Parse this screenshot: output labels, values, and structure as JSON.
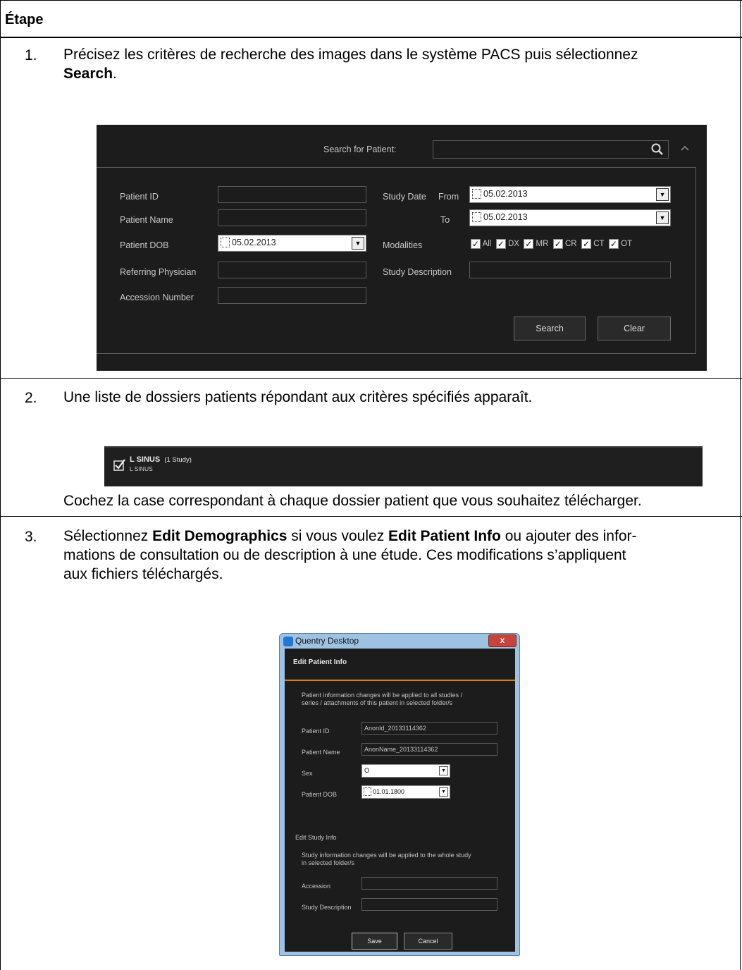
{
  "table": {
    "header": "Étape"
  },
  "step1": {
    "number": "1.",
    "text_before": "Précisez les critères de recherche des images dans le système PACS puis sélectionnez",
    "bold": "Search",
    "text_after": "."
  },
  "search_panel": {
    "search_for_patient_label": "Search for Patient:",
    "patient_id_label": "Patient ID",
    "patient_name_label": "Patient Name",
    "patient_dob_label": "Patient DOB",
    "patient_dob_value": "05.02.2013",
    "referring_physician_label": "Referring Physician",
    "accession_number_label": "Accession Number",
    "study_date_label": "Study Date",
    "from_label": "From",
    "from_value": "05.02.2013",
    "to_label": "To",
    "to_value": "05.02.2013",
    "modalities_label": "Modalities",
    "modalities": [
      "All",
      "DX",
      "MR",
      "CR",
      "CT",
      "OT"
    ],
    "study_description_label": "Study Description",
    "search_button": "Search",
    "clear_button": "Clear"
  },
  "step2": {
    "number": "2.",
    "text": "Une liste de dossiers patients répondant aux critères spécifiés apparaît.",
    "patient_name": "L SINUS",
    "study_count": "(1 Study)",
    "patient_sub": "L SINUS",
    "after_text": "Cochez la case correspondant à chaque dossier patient que vous souhaitez télécharger."
  },
  "step3": {
    "number": "3.",
    "line1_a": "Sélectionnez ",
    "line1_bold1": "Edit Demographics",
    "line1_b": " si vous voulez ",
    "line1_bold2": "Edit Patient Info",
    "line1_c": " ou ajouter des infor-",
    "line2": "mations de consultation ou de description à une étude. Ces modifications s’appliquent",
    "line3": "aux fichiers téléchargés."
  },
  "dialog": {
    "window_title": "Quentry Desktop",
    "close_glyph": "x",
    "header": "Edit Patient Info",
    "info_line1": "Patient information changes will be applied to all studies /",
    "info_line2": "series / attachments of this patient in selected folder/s",
    "patient_id_label": "Patient ID",
    "patient_id_value": "AnonId_20133114362",
    "patient_name_label": "Patient Name",
    "patient_name_value": "AnonName_20133114362",
    "sex_label": "Sex",
    "sex_value": "O",
    "dob_label": "Patient DOB",
    "dob_value": "01.01.1800",
    "study_section": "Edit Study Info",
    "study_info_line1": "Study information changes will be applied to the whole study",
    "study_info_line2": "in selected folder/s",
    "accession_label": "Accession",
    "study_description_label": "Study Description",
    "save_button": "Save",
    "cancel_button": "Cancel"
  },
  "colors": {
    "panel_bg": "#1c1c1c",
    "accent_orange": "#d87b1a",
    "titlebar_blue": "#8fb6d8",
    "close_red": "#c8443a"
  }
}
